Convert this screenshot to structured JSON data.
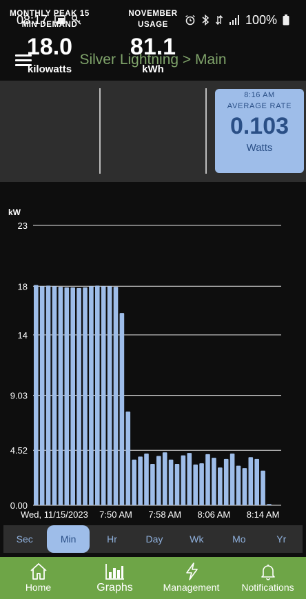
{
  "status_bar": {
    "time": "08:17",
    "left_icons": [
      "screen-cast-icon",
      "key-icon"
    ],
    "right_icons": [
      "alarm-icon",
      "bluetooth-icon",
      "data-icon",
      "signal-icon"
    ],
    "battery": "100%"
  },
  "header": {
    "title": "Silver Lightning > Main"
  },
  "stats": {
    "peak": {
      "label_line1": "MONTHLY PEAK 15",
      "label_line2": "MIN DEMAND",
      "value": "18.0",
      "unit": "kilowatts"
    },
    "usage": {
      "label_line1": "NOVEMBER",
      "label_line2": "USAGE",
      "value": "81.1",
      "unit": "kWh"
    },
    "rate": {
      "time": "8:16 AM",
      "label": "AVERAGE RATE",
      "value": "0.103",
      "unit": "Watts"
    }
  },
  "colors": {
    "accent_blue": "#9ebde9",
    "accent_text": "#2a4f86",
    "nav_green": "#6ea547",
    "title_green": "#7fa36a",
    "panel": "#2e2e2e"
  },
  "chart_data": {
    "type": "bar",
    "ylabel": "kW",
    "ylim": [
      0,
      23
    ],
    "yticks": [
      "0.00",
      "4.52",
      "9.03",
      "14",
      "18",
      "23"
    ],
    "ytick_values": [
      0,
      4.52,
      9.03,
      14,
      18,
      23
    ],
    "xtick_labels": [
      "Wed, 11/15/2023",
      "7:50 AM",
      "7:58 AM",
      "8:06 AM",
      "8:14 AM"
    ],
    "xtick_bar_index": [
      0,
      13,
      21,
      29,
      37
    ],
    "values": [
      18.1,
      18.0,
      18.05,
      18.0,
      17.95,
      17.9,
      17.9,
      17.85,
      17.9,
      18.0,
      18.05,
      18.0,
      18.0,
      17.95,
      15.8,
      7.7,
      3.75,
      4.0,
      4.25,
      3.4,
      4.05,
      4.35,
      3.75,
      3.4,
      4.1,
      4.3,
      3.35,
      3.45,
      4.2,
      3.9,
      3.1,
      3.8,
      4.25,
      3.25,
      3.05,
      3.95,
      3.8,
      2.85,
      0.1
    ],
    "bar_color": "#9ebde9",
    "grid": true
  },
  "ranges": {
    "tabs": [
      "Sec",
      "Min",
      "Hr",
      "Day",
      "Wk",
      "Mo",
      "Yr"
    ],
    "selected": "Min"
  },
  "bottom_nav": {
    "items": [
      {
        "label": "Home",
        "icon": "home-icon"
      },
      {
        "label": "Graphs",
        "icon": "bar-chart-icon"
      },
      {
        "label": "Management",
        "icon": "lightning-icon"
      },
      {
        "label": "Notifications",
        "icon": "bell-icon"
      }
    ],
    "selected": "Graphs"
  }
}
